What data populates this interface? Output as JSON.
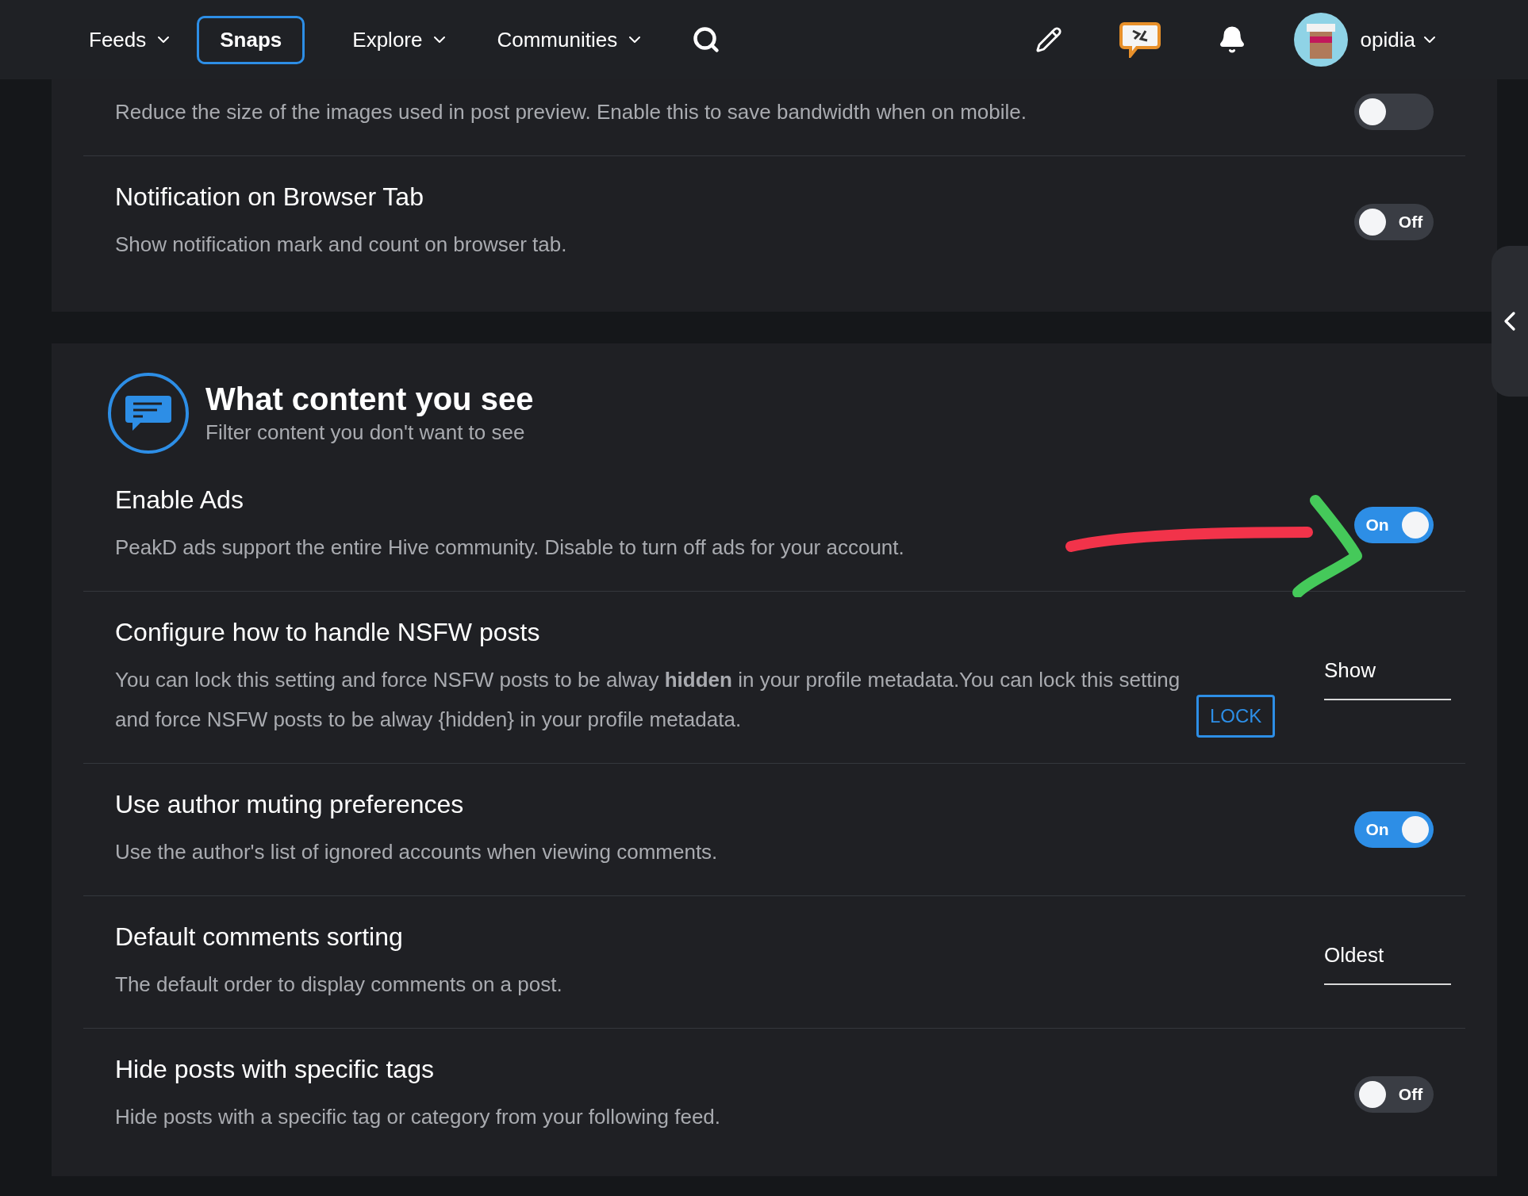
{
  "nav": {
    "items": [
      {
        "label": "Feeds",
        "dropdown": true,
        "selected": false
      },
      {
        "label": "Snaps",
        "dropdown": false,
        "selected": true
      },
      {
        "label": "Explore",
        "dropdown": true,
        "selected": false
      },
      {
        "label": "Communities",
        "dropdown": true,
        "selected": false
      }
    ],
    "user": {
      "name": "opidia"
    }
  },
  "cards": [
    {
      "rows": [
        {
          "description": "Reduce the size of the images used in post preview. Enable this to save bandwidth when on mobile.",
          "control": {
            "kind": "toggle",
            "on": false
          }
        },
        {
          "title": "Notification on Browser Tab",
          "description": "Show notification mark and count on browser tab.",
          "control": {
            "kind": "toggle",
            "on": false,
            "label": "Off"
          }
        }
      ]
    },
    {
      "header": {
        "title": "What content you see",
        "subtitle": "Filter content you don't want to see"
      },
      "rows": [
        {
          "title": "Enable Ads",
          "description": "PeakD ads support the entire Hive community. Disable to turn off ads for your account.",
          "control": {
            "kind": "toggle",
            "on": true,
            "label": "On"
          },
          "annotated": true
        },
        {
          "title": "Configure how to handle NSFW posts",
          "description": "You can lock this setting and force NSFW posts to be alway **hidden** in your profile metadata.You can lock this setting and force NSFW posts to be alway {hidden} in your profile metadata.",
          "action": "LOCK",
          "control": {
            "kind": "select",
            "value": "Show"
          }
        },
        {
          "title": "Use author muting preferences",
          "description": "Use the author's list of ignored accounts when viewing comments.",
          "control": {
            "kind": "toggle",
            "on": true,
            "label": "On"
          }
        },
        {
          "title": "Default comments sorting",
          "description": "The default order to display comments on a post.",
          "control": {
            "kind": "select",
            "value": "Oldest"
          }
        },
        {
          "title": "Hide posts with specific tags",
          "description": "Hide posts with a specific tag or category from your following feed.",
          "control": {
            "kind": "toggle",
            "on": false,
            "label": "Off"
          }
        }
      ]
    }
  ]
}
